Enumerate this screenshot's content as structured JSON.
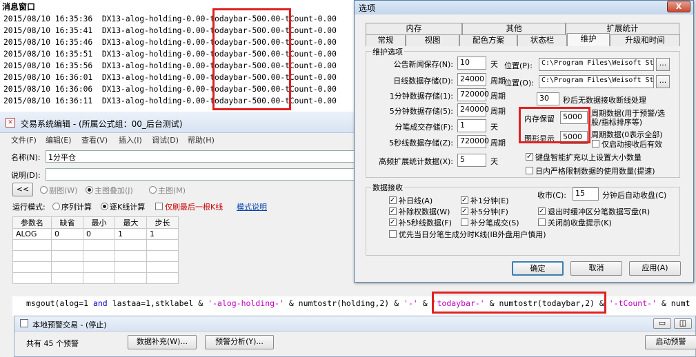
{
  "message_window": {
    "title": "消息窗口",
    "lines": [
      "2015/08/10 16:35:36  DX13-alog-holding-0.00-todaybar-500.00-tCount-0.00",
      "2015/08/10 16:35:41  DX13-alog-holding-0.00-todaybar-500.00-tCount-0.00",
      "2015/08/10 16:35:46  DX13-alog-holding-0.00-todaybar-500.00-tCount-0.00",
      "2015/08/10 16:35:51  DX13-alog-holding-0.00-todaybar-500.00-tCount-0.00",
      "2015/08/10 16:35:56  DX13-alog-holding-0.00-todaybar-500.00-tCount-0.00",
      "2015/08/10 16:36:01  DX13-alog-holding-0.00-todaybar-500.00-tCount-0.00",
      "2015/08/10 16:36:06  DX13-alog-holding-0.00-todaybar-500.00-tCount-0.00",
      "2015/08/10 16:36:11  DX13-alog-holding-0.00-todaybar-500.00-tCount-0.00"
    ]
  },
  "editor": {
    "title": "交易系统编辑 - (所属公式组：00_后台测试)",
    "menu": [
      "文件(F)",
      "编辑(E)",
      "查看(V)",
      "插入(I)",
      "调试(D)",
      "帮助(H)"
    ],
    "name_label": "名称(N):",
    "name_value": "1分平仓",
    "desc_label": "说明(D):",
    "desc_value": "",
    "collapse_btn": "<<",
    "chart_modes": [
      "副图(W)",
      "主图叠加(J)",
      "主图(M)"
    ],
    "run_mode_label": "运行模式:",
    "run_modes": [
      "序列计算",
      "逐K线计算"
    ],
    "last_bar_only": "仅刷最后一根K线",
    "mode_help": "模式说明",
    "param_headers": [
      "参数名",
      "缺省",
      "最小",
      "最大",
      "步长"
    ],
    "param_rows": [
      [
        "ALOG",
        "0",
        "0",
        "1",
        "1"
      ]
    ]
  },
  "code": {
    "segments": [
      {
        "t": "msgout(alog=1 ",
        "c": "plain"
      },
      {
        "t": "and",
        "c": "kw"
      },
      {
        "t": " lastaa=1,stklabel & ",
        "c": "plain"
      },
      {
        "t": "'-alog-holding-'",
        "c": "str"
      },
      {
        "t": " & numtostr(holding,2) & ",
        "c": "plain"
      },
      {
        "t": "'-'",
        "c": "str"
      },
      {
        "t": " & ",
        "c": "plain"
      },
      {
        "t": "'todaybar-'",
        "c": "str"
      },
      {
        "t": " & numtostr(todaybar,2) ",
        "c": "plain"
      },
      {
        "t": "& ",
        "c": "plain"
      },
      {
        "t": "'-tCount-'",
        "c": "str"
      },
      {
        "t": " & numt",
        "c": "plain"
      }
    ]
  },
  "alert_window": {
    "title": "本地预警交易 - (停止)",
    "count_text": "共有 45 个预警",
    "btn_fill": "数据补充(W)...",
    "btn_analyze": "预警分析(Y)...",
    "btn_start": "启动预警"
  },
  "dialog": {
    "title": "选项",
    "close": "X",
    "tabs_row1": [
      "内存",
      "其他",
      "扩展统计"
    ],
    "tabs_row2": [
      "常规",
      "视图",
      "配色方案",
      "状态栏",
      "维护",
      "升级和时间"
    ],
    "group_maintain": "维护选项",
    "fields": [
      {
        "label": "公告新闻保存(N):",
        "value": "10",
        "unit": "天"
      },
      {
        "label": "日线数据存储(D):",
        "value": "24000",
        "unit": "周期"
      },
      {
        "label": "1分钟数据存储(1):",
        "value": "720000",
        "unit": "周期"
      },
      {
        "label": "5分钟数据存储(5):",
        "value": "240000",
        "unit": "周期"
      },
      {
        "label": "分笔成交存储(F):",
        "value": "1",
        "unit": "天"
      },
      {
        "label": "5秒线数据存储(Z):",
        "value": "720000",
        "unit": "周期"
      },
      {
        "label": "高频扩展统计数据(X):",
        "value": "5",
        "unit": "天"
      }
    ],
    "loc1_label": "位置(P):",
    "loc1_value": "C:\\Program Files\\Weisoft St",
    "loc2_label": "位置(O):",
    "loc2_value": "C:\\Program Files\\Weisoft St",
    "dots": "...",
    "reconnect_value": "30",
    "reconnect_text": "秒后无数据接收断线处理",
    "mem_keep_label": "内存保留",
    "mem_keep_value": "5000",
    "mem_keep_text": "周期数据(用于预警/选股/指标排序等)",
    "graph_label": "图形显示",
    "graph_value": "5000",
    "graph_text": "周期数据(0表示全部)",
    "opt_valid_after": "仅启动接收后有效",
    "opt_smart": "键盘智能扩充以上设置大小数量",
    "opt_strict": "日内严格限制数据的使用数量(提速)",
    "group_receive": "数据接收",
    "recv_left": [
      "补日线(A)",
      "补除权数据(W)",
      "补5秒线数据(F)"
    ],
    "recv_mid": [
      "补1分钟(E)",
      "补5分钟(F)",
      "补分笔成交(S)"
    ],
    "recv_right": [
      "退出时缓冲区分笔数据写盘(R)",
      "关闭前收盘提示(K)"
    ],
    "recv_last": "优先当日分笔生成分时K线(IB外盘用户慎用)",
    "close_mkt_label": "收市(C):",
    "close_mkt_value": "15",
    "close_mkt_text": "分钟后自动收盘(C)",
    "ok": "确定",
    "cancel": "取消",
    "apply": "应用(A)"
  },
  "colors": {
    "highlight": "#e02020",
    "keyword": "#0000c0",
    "string": "#c000c0"
  }
}
